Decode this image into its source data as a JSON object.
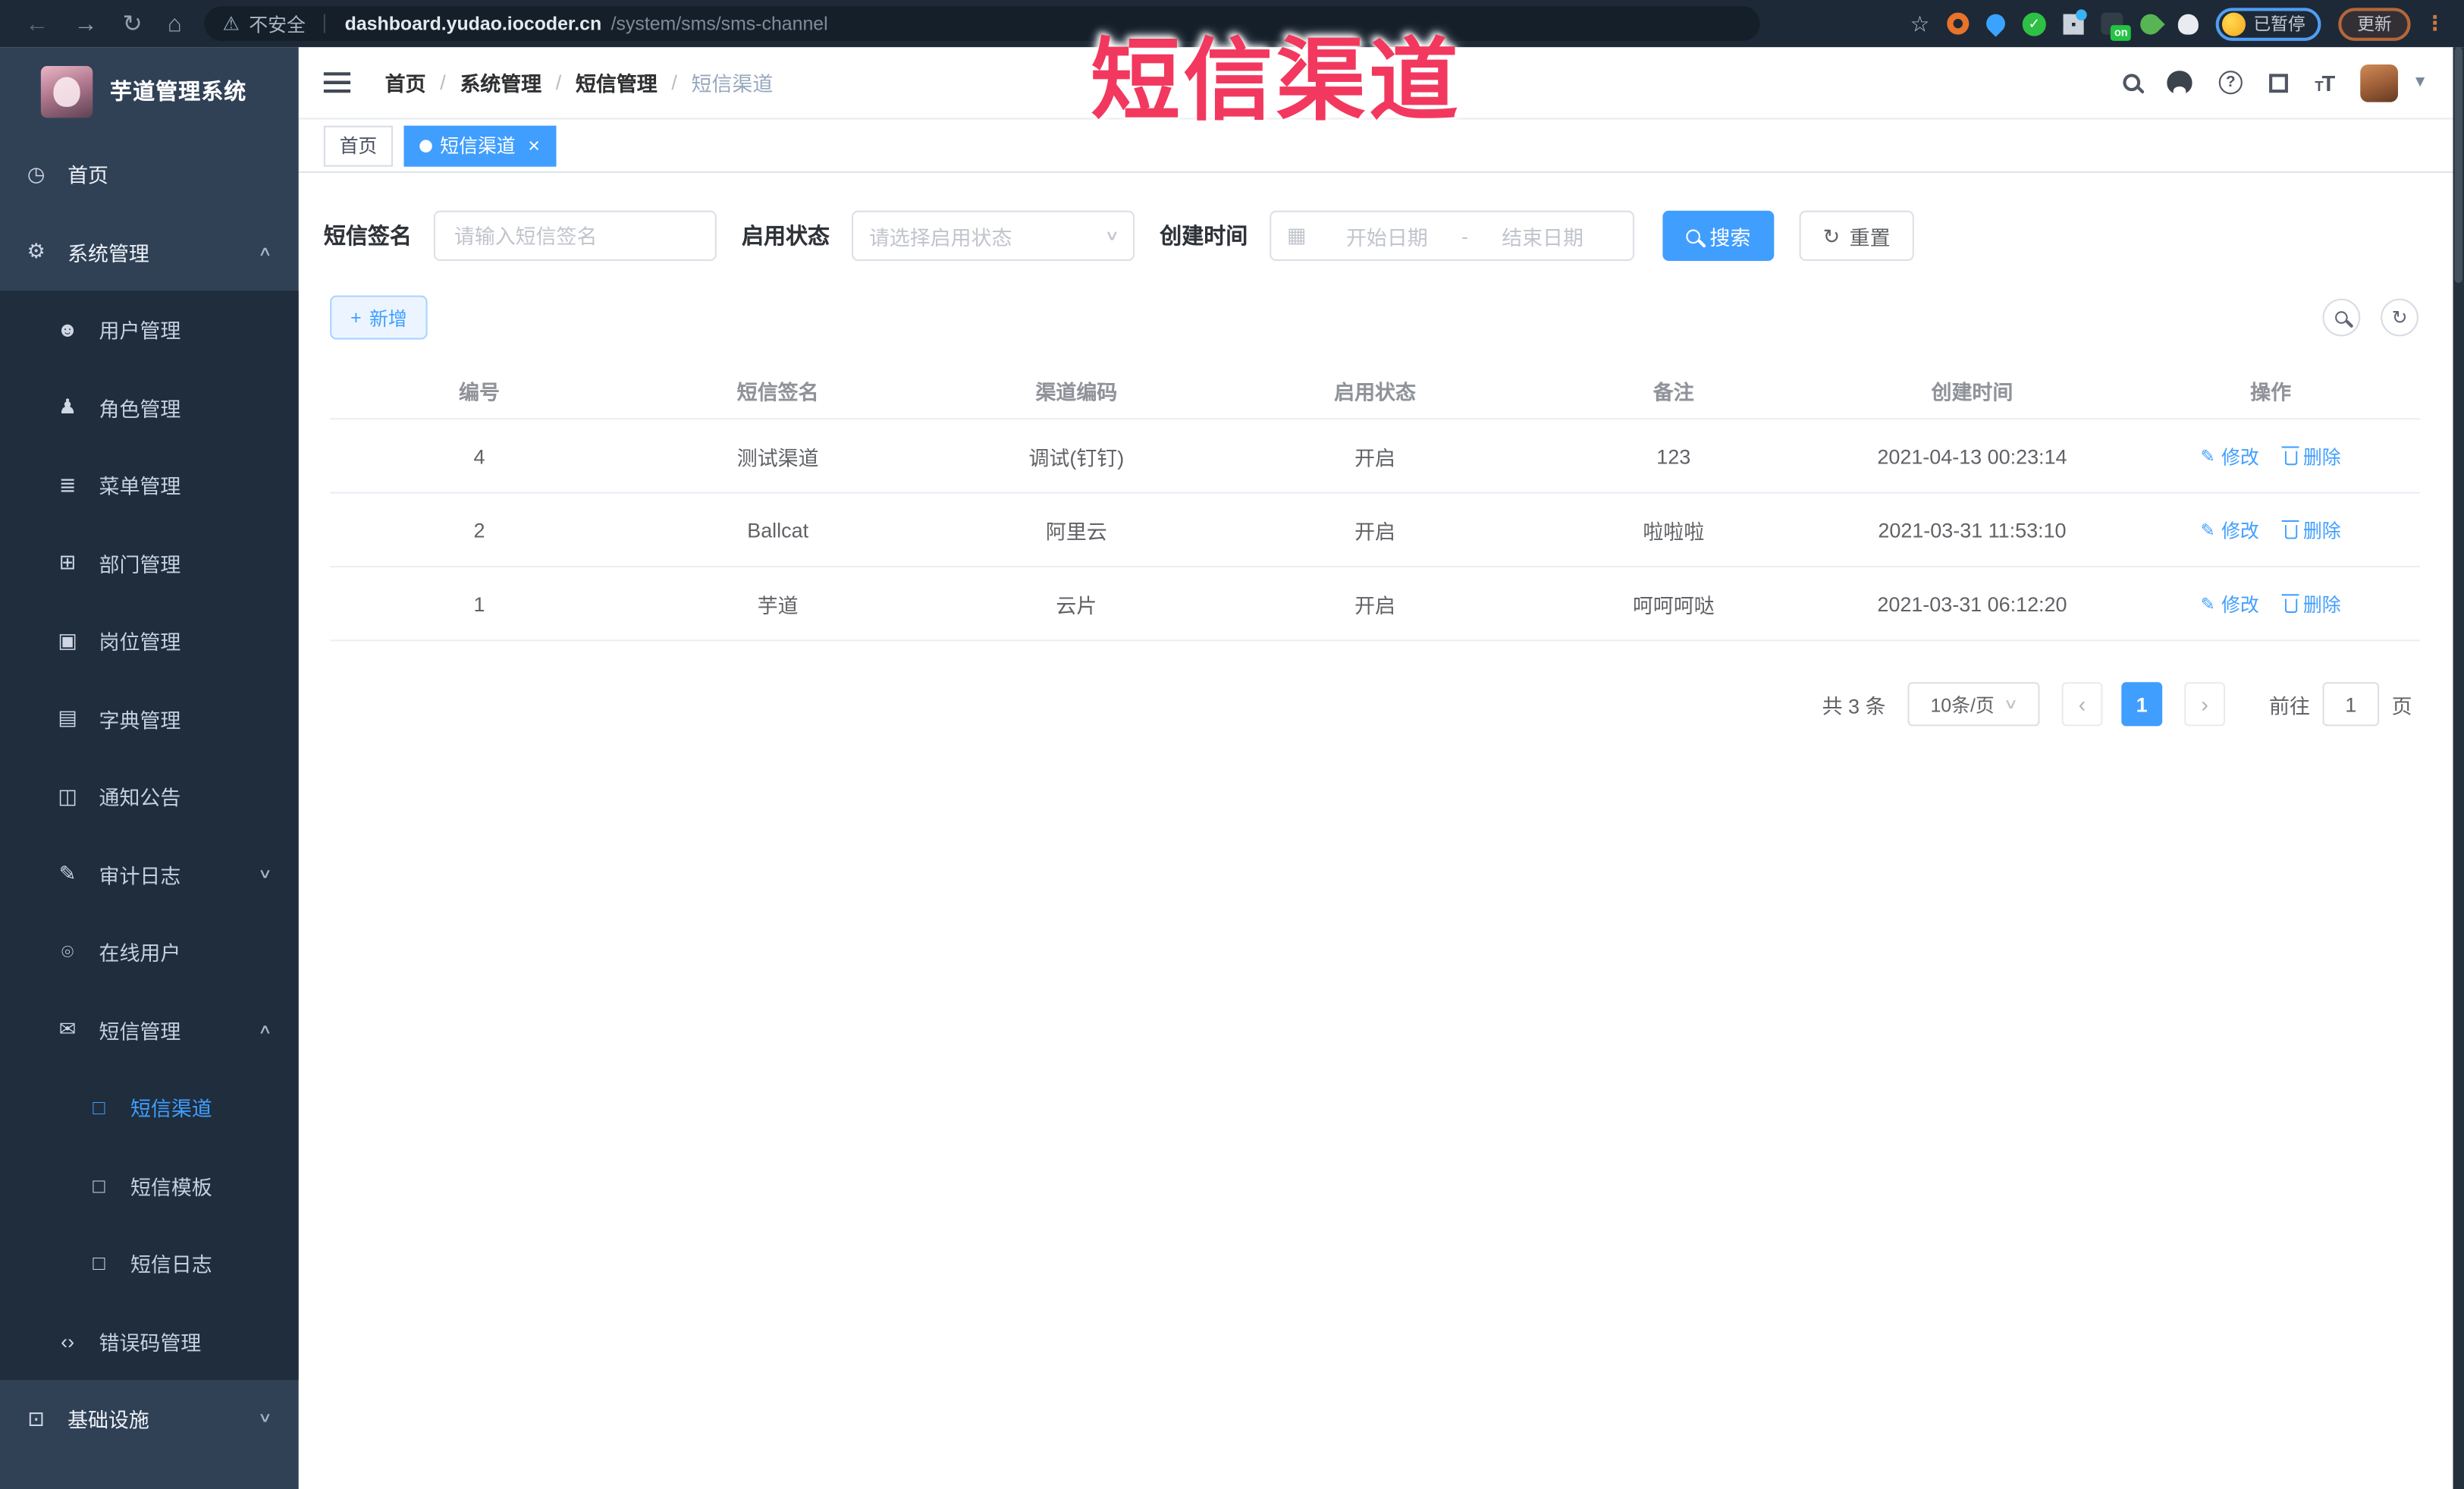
{
  "colors": {
    "accent": "#409eff",
    "sidebar_bg": "#304156",
    "submenu_bg": "#1f2d3d",
    "topbar_bg": "#1d2936",
    "overlay_red": "#f2385e"
  },
  "browser": {
    "security_label": "不安全",
    "url_host": "dashboard.yudao.iocoder.cn",
    "url_path": "/system/sms/sms-channel",
    "ext_on_badge": "on",
    "paused_label": "已暂停",
    "update_label": "更新"
  },
  "overlay": {
    "title": "短信渠道"
  },
  "sidebar": {
    "app_title": "芋道管理系统",
    "items": [
      {
        "label": "首页"
      },
      {
        "label": "系统管理"
      },
      {
        "label": "用户管理"
      },
      {
        "label": "角色管理"
      },
      {
        "label": "菜单管理"
      },
      {
        "label": "部门管理"
      },
      {
        "label": "岗位管理"
      },
      {
        "label": "字典管理"
      },
      {
        "label": "通知公告"
      },
      {
        "label": "审计日志"
      },
      {
        "label": "在线用户"
      },
      {
        "label": "短信管理"
      },
      {
        "label": "短信渠道"
      },
      {
        "label": "短信模板"
      },
      {
        "label": "短信日志"
      },
      {
        "label": "错误码管理"
      },
      {
        "label": "基础设施"
      }
    ]
  },
  "header": {
    "breadcrumb": [
      "首页",
      "系统管理",
      "短信管理",
      "短信渠道"
    ]
  },
  "tags": [
    {
      "label": "首页"
    },
    {
      "label": "短信渠道"
    }
  ],
  "filters": {
    "sign_label": "短信签名",
    "sign_placeholder": "请输入短信签名",
    "status_label": "启用状态",
    "status_placeholder": "请选择启用状态",
    "date_label": "创建时间",
    "date_start_placeholder": "开始日期",
    "date_separator": "-",
    "date_end_placeholder": "结束日期",
    "search_label": "搜索",
    "reset_label": "重置"
  },
  "toolbar": {
    "add_label": "新增"
  },
  "table": {
    "headers": [
      "编号",
      "短信签名",
      "渠道编码",
      "启用状态",
      "备注",
      "创建时间",
      "操作"
    ],
    "edit_label": "修改",
    "delete_label": "删除",
    "rows": [
      {
        "id": "4",
        "sign": "测试渠道",
        "code": "调试(钉钉)",
        "status": "开启",
        "remark": "123",
        "created": "2021-04-13 00:23:14"
      },
      {
        "id": "2",
        "sign": "Ballcat",
        "code": "阿里云",
        "status": "开启",
        "remark": "啦啦啦",
        "created": "2021-03-31 11:53:10"
      },
      {
        "id": "1",
        "sign": "芋道",
        "code": "云片",
        "status": "开启",
        "remark": "呵呵呵哒",
        "created": "2021-03-31 06:12:20"
      }
    ]
  },
  "pagination": {
    "total": "共 3 条",
    "page_size": "10条/页",
    "current_page": "1",
    "goto_label": "前往",
    "goto_value": "1",
    "page_suffix": "页"
  }
}
